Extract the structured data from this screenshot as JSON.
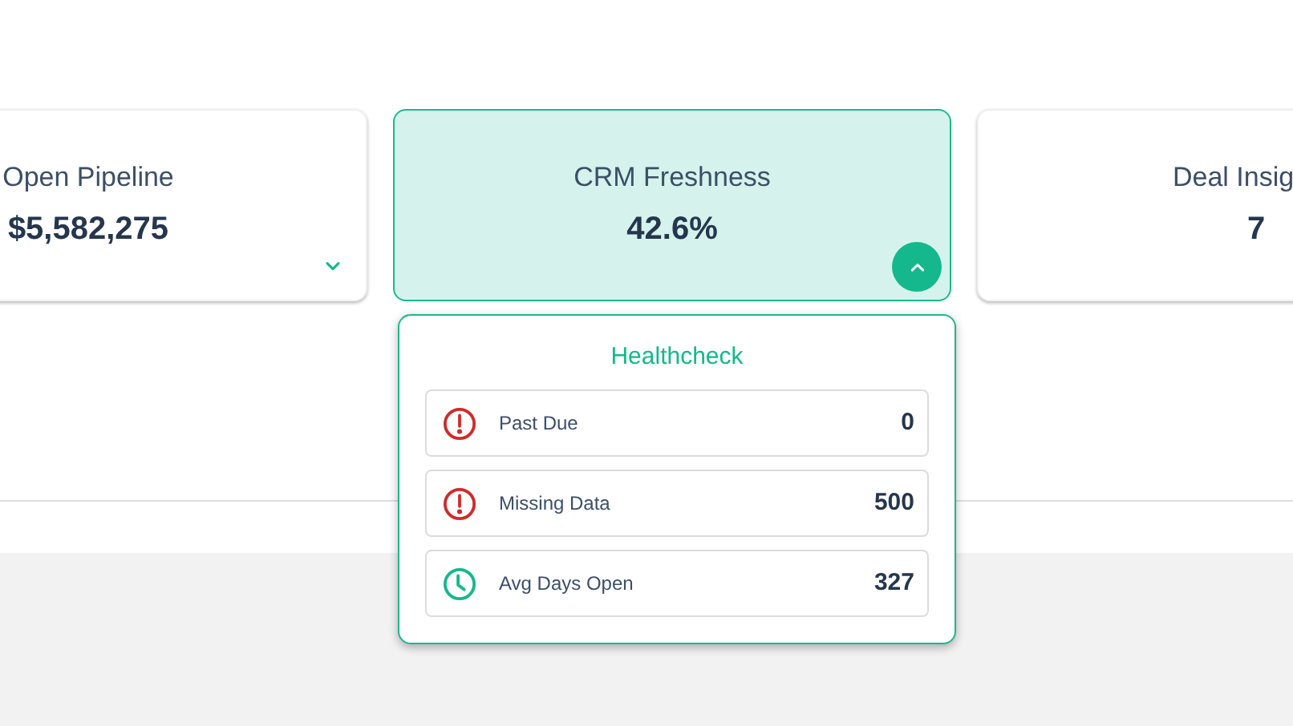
{
  "cards": [
    {
      "title": "Open Pipeline",
      "value": "$5,582,275",
      "selected": false,
      "expanded": false
    },
    {
      "title": "CRM Freshness",
      "value": "42.6%",
      "selected": true,
      "expanded": true
    },
    {
      "title": "Deal Insig",
      "value": "7",
      "selected": false
    }
  ],
  "healthcheck": {
    "title": "Healthcheck",
    "items": [
      {
        "label": "Past Due",
        "value": "0",
        "kind": "alert"
      },
      {
        "label": "Missing Data",
        "value": "500",
        "kind": "alert"
      },
      {
        "label": "Avg Days Open",
        "value": "327",
        "kind": "clock"
      }
    ]
  }
}
